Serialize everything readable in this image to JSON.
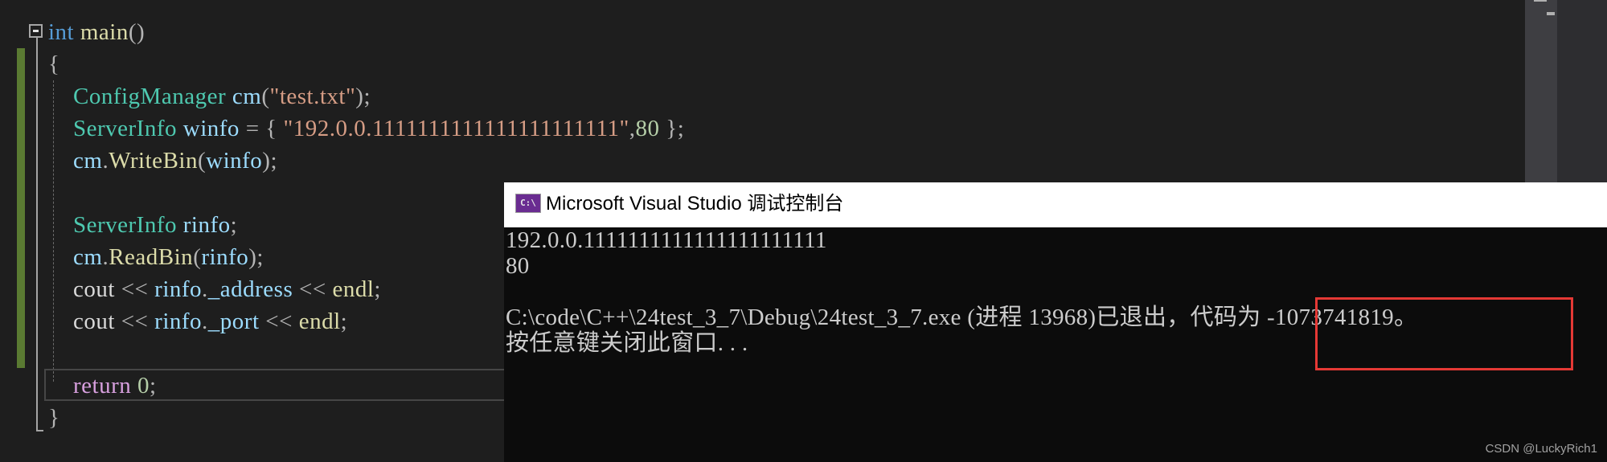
{
  "editor": {
    "lines": [
      {
        "tokens": [
          {
            "t": "int",
            "c": "kw"
          },
          {
            "t": " ",
            "c": "plain"
          },
          {
            "t": "main",
            "c": "fn"
          },
          {
            "t": "()",
            "c": "pn"
          }
        ]
      },
      {
        "tokens": [
          {
            "t": "{",
            "c": "pn"
          }
        ]
      },
      {
        "tokens": [
          {
            "t": "    ",
            "c": "plain"
          },
          {
            "t": "ConfigManager",
            "c": "ty"
          },
          {
            "t": " ",
            "c": "plain"
          },
          {
            "t": "cm",
            "c": "var"
          },
          {
            "t": "(",
            "c": "pn"
          },
          {
            "t": "\"test.txt\"",
            "c": "str"
          },
          {
            "t": ");",
            "c": "pn"
          }
        ]
      },
      {
        "tokens": [
          {
            "t": "    ",
            "c": "plain"
          },
          {
            "t": "ServerInfo",
            "c": "ty"
          },
          {
            "t": " ",
            "c": "plain"
          },
          {
            "t": "winfo",
            "c": "var"
          },
          {
            "t": " = { ",
            "c": "pn"
          },
          {
            "t": "\"192.0.0.1111111111111111111111\"",
            "c": "str"
          },
          {
            "t": ",",
            "c": "pn"
          },
          {
            "t": "80",
            "c": "num"
          },
          {
            "t": " };",
            "c": "pn"
          }
        ]
      },
      {
        "tokens": [
          {
            "t": "    ",
            "c": "plain"
          },
          {
            "t": "cm",
            "c": "var"
          },
          {
            "t": ".",
            "c": "pn"
          },
          {
            "t": "WriteBin",
            "c": "fn"
          },
          {
            "t": "(",
            "c": "pn"
          },
          {
            "t": "winfo",
            "c": "var"
          },
          {
            "t": ");",
            "c": "pn"
          }
        ]
      },
      {
        "tokens": []
      },
      {
        "tokens": [
          {
            "t": "    ",
            "c": "plain"
          },
          {
            "t": "ServerInfo",
            "c": "ty"
          },
          {
            "t": " ",
            "c": "plain"
          },
          {
            "t": "rinfo",
            "c": "var"
          },
          {
            "t": ";",
            "c": "pn"
          }
        ]
      },
      {
        "tokens": [
          {
            "t": "    ",
            "c": "plain"
          },
          {
            "t": "cm",
            "c": "var"
          },
          {
            "t": ".",
            "c": "pn"
          },
          {
            "t": "ReadBin",
            "c": "fn"
          },
          {
            "t": "(",
            "c": "pn"
          },
          {
            "t": "rinfo",
            "c": "var"
          },
          {
            "t": ");",
            "c": "pn"
          }
        ]
      },
      {
        "tokens": [
          {
            "t": "    ",
            "c": "plain"
          },
          {
            "t": "cout",
            "c": "plain"
          },
          {
            "t": " << ",
            "c": "pn"
          },
          {
            "t": "rinfo",
            "c": "var"
          },
          {
            "t": ".",
            "c": "pn"
          },
          {
            "t": "_address",
            "c": "var"
          },
          {
            "t": " << ",
            "c": "pn"
          },
          {
            "t": "endl",
            "c": "fn"
          },
          {
            "t": ";",
            "c": "pn"
          }
        ]
      },
      {
        "tokens": [
          {
            "t": "    ",
            "c": "plain"
          },
          {
            "t": "cout",
            "c": "plain"
          },
          {
            "t": " << ",
            "c": "pn"
          },
          {
            "t": "rinfo",
            "c": "var"
          },
          {
            "t": ".",
            "c": "pn"
          },
          {
            "t": "_port",
            "c": "var"
          },
          {
            "t": " << ",
            "c": "pn"
          },
          {
            "t": "endl",
            "c": "fn"
          },
          {
            "t": ";",
            "c": "pn"
          }
        ]
      },
      {
        "tokens": []
      },
      {
        "tokens": [
          {
            "t": "    ",
            "c": "plain"
          },
          {
            "t": "return",
            "c": "ctl"
          },
          {
            "t": " ",
            "c": "plain"
          },
          {
            "t": "0",
            "c": "num"
          },
          {
            "t": ";",
            "c": "pn"
          }
        ]
      },
      {
        "tokens": [
          {
            "t": "}",
            "c": "pn"
          }
        ]
      }
    ]
  },
  "console": {
    "icon_text": "C:\\",
    "title": "Microsoft Visual Studio 调试控制台",
    "lines": [
      "192.0.0.1111111111111111111111",
      "80",
      "",
      "C:\\code\\C++\\24test_3_7\\Debug\\24test_3_7.exe (进程 13968)已退出，代码为 -1073741819。",
      "按任意键关闭此窗口. . ."
    ]
  },
  "watermark": "CSDN @LuckyRich1",
  "colors": {
    "highlight_box": "#e53935",
    "change_bar": "#5a7a32"
  }
}
